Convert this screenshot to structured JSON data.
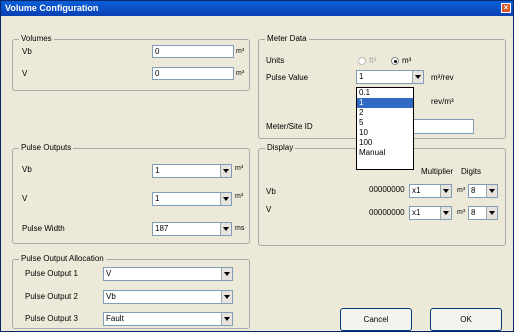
{
  "window": {
    "title": "Volume Configuration",
    "close_label": "×"
  },
  "volumes": {
    "title": "Volumes",
    "vb_label": "Vb",
    "vb_value": "0",
    "vb_unit": "m³",
    "v_label": "V",
    "v_value": "0",
    "v_unit": "m³"
  },
  "pulse_outputs": {
    "title": "Pulse Outputs",
    "vb_label": "Vb",
    "vb_value": "1",
    "vb_unit": "m³",
    "v_label": "V",
    "v_value": "1",
    "v_unit": "m³",
    "width_label": "Pulse Width",
    "width_value": "187",
    "width_unit": "ms"
  },
  "pulse_alloc": {
    "title": "Pulse Output Allocation",
    "items": [
      {
        "label": "Pulse Output 1",
        "value": "V"
      },
      {
        "label": "Pulse Output 2",
        "value": "Vb"
      },
      {
        "label": "Pulse Output 3",
        "value": "Fault"
      }
    ]
  },
  "meter": {
    "title": "Meter Data",
    "units_label": "Units",
    "unit_ft": "ft³",
    "unit_m": "m³",
    "pulse_label": "Pulse Value",
    "pulse_value": "1",
    "pulse_unit": "m³/rev",
    "rev_unit": "rev/m³",
    "site_label": "Meter/Site ID",
    "site_value": ""
  },
  "dropdown": {
    "options": [
      "0.1",
      "1",
      "2",
      "5",
      "10",
      "100",
      "Manual"
    ],
    "selected_index": 1
  },
  "display": {
    "title": "Display",
    "multiplier_label": "Multiplier",
    "digits_label": "Digits",
    "rows": [
      {
        "label": "Vb",
        "counter": "00000000",
        "multiplier": "x1",
        "unit": "m³",
        "digits": "8"
      },
      {
        "label": "V",
        "counter": "00000000",
        "multiplier": "x1",
        "unit": "m³",
        "digits": "8"
      }
    ]
  },
  "buttons": {
    "cancel": "Cancel",
    "ok": "OK"
  }
}
